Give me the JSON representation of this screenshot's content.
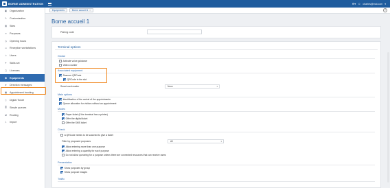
{
  "app": {
    "brand": "BORNE ADMINISTRATION",
    "user": "charles@mol.com"
  },
  "sidebar": {
    "items": [
      {
        "label": "Organization",
        "icon": "▣"
      },
      {
        "label": "Customization",
        "icon": "✎"
      },
      {
        "label": "Sites",
        "icon": "▤"
      },
      {
        "label": "Purposes",
        "icon": "≡"
      },
      {
        "label": "Opening hours",
        "icon": "◷"
      },
      {
        "label": "Reception workstations",
        "icon": "▭"
      },
      {
        "label": "Users",
        "icon": "☺"
      },
      {
        "label": "Skills set",
        "icon": "✦"
      },
      {
        "label": "Licenses",
        "icon": "▢"
      },
      {
        "label": "Equipments",
        "icon": "⚙"
      },
      {
        "label": "Direction messages",
        "icon": "➤"
      },
      {
        "label": "Appointment booking",
        "icon": "▦"
      },
      {
        "label": "Digital Ticket",
        "icon": "▯"
      },
      {
        "label": "Simple queues",
        "icon": "≣"
      },
      {
        "label": "Routing",
        "icon": "⇄"
      },
      {
        "label": "Import",
        "icon": "⇩"
      }
    ],
    "active_index": 9
  },
  "breadcrumb": {
    "items": [
      "Equipments",
      "Borne accueil 1"
    ]
  },
  "page": {
    "title": "Borne accueil 1",
    "pairing_code_label": "Pairing code"
  },
  "terminal": {
    "title": "Terminal options",
    "global": {
      "heading": "Global",
      "options": [
        {
          "label": "Activate voice guidance",
          "checked": false
        },
        {
          "label": "Video counter",
          "checked": false
        }
      ]
    },
    "associated": {
      "heading": "Associated equipment",
      "options": [
        {
          "label": "Scanner QRCode",
          "checked": true
        },
        {
          "label": "QRCode in the slot",
          "checked": true
        }
      ],
      "smart_card_label": "Smart card reader",
      "smart_card_value": "None"
    },
    "main": {
      "heading": "Main options",
      "options": [
        {
          "label": "Identification of the arrival of the appointments",
          "checked": true
        },
        {
          "label": "Queue allocation for visitors without an appointment",
          "checked": true
        }
      ]
    },
    "modes": {
      "heading": "Modes",
      "options": [
        {
          "label": "Paper ticket (if the terminal has a printer)",
          "checked": true
        },
        {
          "label": "Offer the digital ticket",
          "checked": true
        },
        {
          "label": "Offer the SMS ticket",
          "checked": false
        }
      ]
    },
    "check": {
      "heading": "Check",
      "options": [
        {
          "label": "A QRCode needs to be scanned to give a ticket",
          "checked": false
        }
      ],
      "filter_label": "Filter by proposed purposes",
      "filter_value": "All",
      "options2": [
        {
          "label": "Allow entering more than one purpose",
          "checked": true
        },
        {
          "label": "Allow entering a quantity for each purpose",
          "checked": true
        },
        {
          "label": "Do not allow queueing for a purpose unless there are connected resources that can receive users",
          "checked": false
        }
      ]
    },
    "presentation": {
      "heading": "Presentation",
      "options": [
        {
          "label": "Show purposes by group",
          "checked": true
        },
        {
          "label": "Show purpose images",
          "checked": true
        }
      ]
    },
    "traffic": {
      "heading": "Traffic"
    }
  },
  "colors": {
    "topbar": "#1f5c9e",
    "accent": "#2f6bb0",
    "highlight": "#f08a24"
  }
}
